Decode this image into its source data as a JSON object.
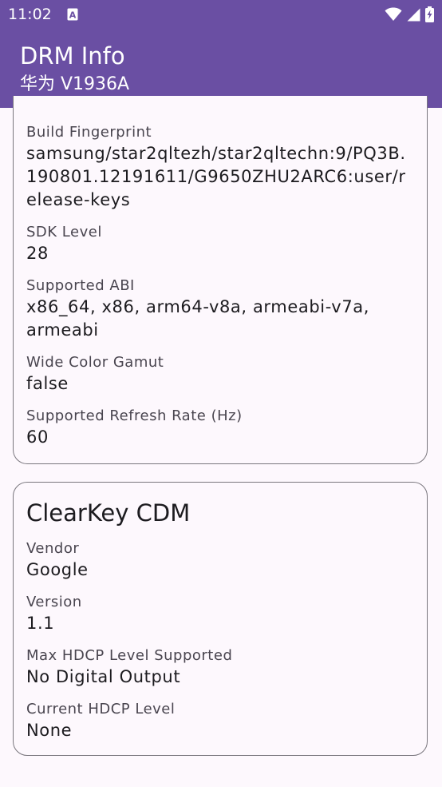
{
  "status_bar": {
    "time": "11:02",
    "notification_icon": "a-icon",
    "icons": [
      "wifi-icon",
      "signal-icon",
      "battery-charging-icon"
    ]
  },
  "app_bar": {
    "title": "DRM Info",
    "subtitle": "华为 V1936A"
  },
  "device_card": {
    "fields": [
      {
        "label": "Build Fingerprint",
        "value": "samsung/star2qltezh/star2qltechn:9/PQ3B.190801.12191611/G9650ZHU2ARC6:user/release-keys"
      },
      {
        "label": "SDK Level",
        "value": "28"
      },
      {
        "label": "Supported ABI",
        "value": "x86_64, x86, arm64-v8a, armeabi-v7a, armeabi"
      },
      {
        "label": "Wide Color Gamut",
        "value": "false"
      },
      {
        "label": "Supported Refresh Rate (Hz)",
        "value": "60"
      }
    ]
  },
  "clearkey_card": {
    "title": "ClearKey CDM",
    "fields": [
      {
        "label": "Vendor",
        "value": "Google"
      },
      {
        "label": "Version",
        "value": "1.1"
      },
      {
        "label": "Max HDCP Level Supported",
        "value": "No Digital Output"
      },
      {
        "label": "Current HDCP Level",
        "value": "None"
      }
    ]
  },
  "colors": {
    "app_bar": "#6a4fa3",
    "background": "#fdf8fd",
    "card_border": "#79767d",
    "label_text": "#49454f",
    "value_text": "#1c1b1f"
  }
}
